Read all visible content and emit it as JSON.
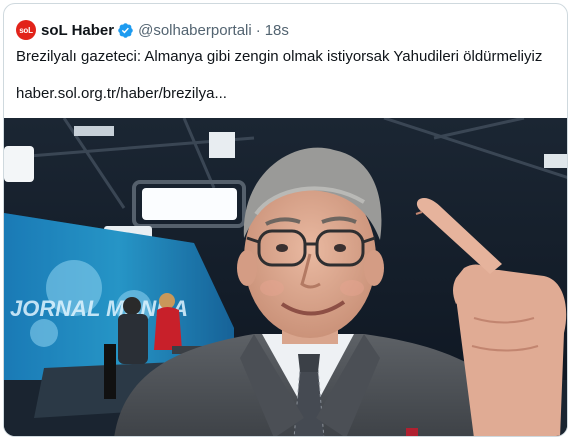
{
  "author": {
    "avatar_text": "soL",
    "display_name": "soL Haber",
    "handle": "@solhaberportali",
    "separator": "·",
    "time": "18s"
  },
  "tweet": {
    "text": "Brezilyalı gazeteci: Almanya gibi zengin olmak istiyorsak Yahudileri öldürmeliyiz",
    "link": "haber.sol.org.tr/haber/brezilya..."
  },
  "media": {
    "alt": "TV studio selfie",
    "screen_text": "JORNAL MANHA"
  },
  "colors": {
    "verified": "#1d9bf0",
    "avatar_bg": "#e2231a",
    "border": "#cfd9de",
    "secondary_text": "#536471"
  },
  "icons": {
    "verified": "verified-badge-icon"
  }
}
